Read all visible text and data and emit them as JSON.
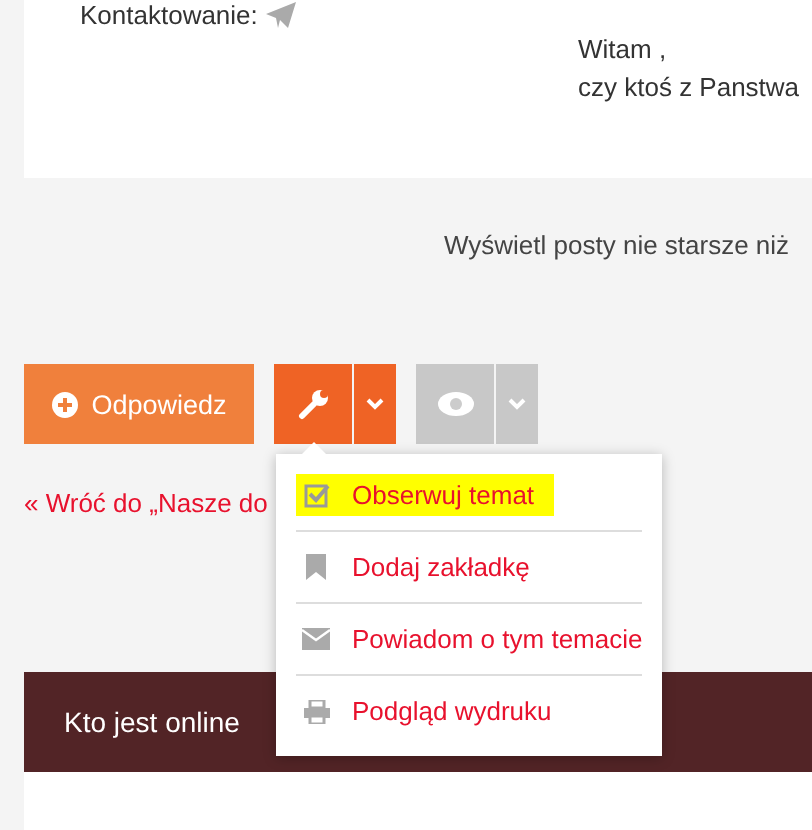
{
  "post": {
    "contact_label": "Kontaktowanie:",
    "lines": [
      "Witam ,",
      "czy ktoś z Panstwa"
    ]
  },
  "filter_text": "Wyświetl posty nie starsze niż",
  "actions": {
    "reply_button": "Odpowiedz"
  },
  "back_link": "« Wróć do „Nasze do",
  "tools_menu": {
    "items": [
      {
        "kind": "checkbox",
        "label": "Obserwuj temat",
        "highlighted": true
      },
      {
        "kind": "bookmark",
        "label": "Dodaj zakładkę",
        "highlighted": false
      },
      {
        "kind": "envelope",
        "label": "Powiadom o tym temacie",
        "highlighted": false
      },
      {
        "kind": "printer",
        "label": "Podgląd wydruku",
        "highlighted": false
      }
    ]
  },
  "online": {
    "title": "Kto jest online"
  }
}
